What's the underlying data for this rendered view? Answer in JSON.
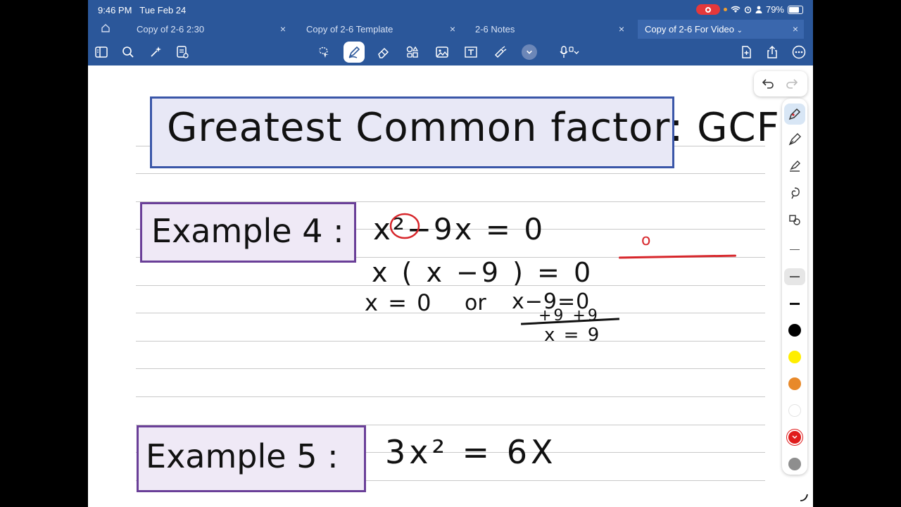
{
  "status": {
    "time": "9:46 PM",
    "date": "Tue Feb 24",
    "battery": "79%"
  },
  "tabs": [
    {
      "label": "Copy of 2-6 2:30",
      "active": false
    },
    {
      "label": "Copy of 2-6 Template",
      "active": false
    },
    {
      "label": "2-6 Notes",
      "active": false
    },
    {
      "label": "Copy of 2-6 For Video",
      "active": true
    }
  ],
  "tab_close": "×",
  "toolbar": {
    "left": [
      "sidebar-icon",
      "search-icon",
      "sparkle-icon",
      "notes-list-icon"
    ],
    "center": [
      "lasso-icon",
      "pen-icon",
      "eraser-icon",
      "shapes-icon",
      "image-icon",
      "text-box-icon",
      "highlighter-tape-icon",
      "chevron-down-icon",
      "mic-icon"
    ],
    "right": [
      "add-page-icon",
      "share-icon",
      "more-icon"
    ]
  },
  "note": {
    "title": "Greatest Common factor: GCF",
    "example4_label": "Example 4 :",
    "example4_line1": "x²−9x = 0",
    "example4_line2": "x ( x −9 ) = 0",
    "example4_line3a": "x = 0",
    "example4_or": "or",
    "example4_line3b": "x−9=0",
    "example4_line4": "+9 +9",
    "example4_line5": "x = 9",
    "red_mark": "o",
    "example5_label": "Example 5 :",
    "example5_eq": "3x² = 6X"
  },
  "colors": {
    "title_box_fill": "#e8e8f6",
    "title_box_border": "#3a56a8",
    "example_box_fill": "#efe9f6",
    "example_box_border": "#6a3f98",
    "ink_red": "#d7262b",
    "app_blue": "#2b579a"
  },
  "palette": {
    "tools": [
      "ballpoint-pen-icon",
      "fountain-pen-icon",
      "highlighter-icon",
      "pencil-lasso-icon",
      "shape-pen-icon"
    ],
    "widths": [
      "thin",
      "medium",
      "thick"
    ],
    "swatches": [
      "#000000",
      "#ffee00",
      "#e8892a",
      "#ffffff",
      "#e01b1b",
      "#8e8e8e"
    ],
    "selected_swatch": 4
  }
}
